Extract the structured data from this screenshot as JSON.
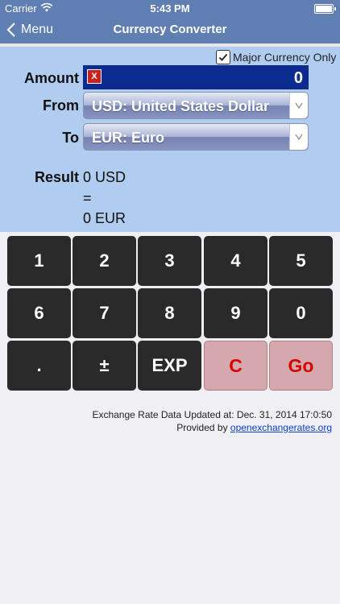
{
  "status": {
    "carrier": "Carrier",
    "time": "5:43 PM"
  },
  "nav": {
    "back_label": "Menu",
    "title": "Currency Converter"
  },
  "form": {
    "major_only_label": "Major Currency Only",
    "major_only_checked": true,
    "amount_label": "Amount",
    "amount_value": "0",
    "clear_label": "X",
    "from_label": "From",
    "from_value": "USD: United States Dollar",
    "to_label": "To",
    "to_value": "EUR: Euro",
    "result_label": "Result",
    "result_from": "0 USD",
    "result_eq": "=",
    "result_to": "0 EUR"
  },
  "keypad": {
    "rows": [
      [
        "1",
        "2",
        "3",
        "4",
        "5"
      ],
      [
        "6",
        "7",
        "8",
        "9",
        "0"
      ],
      [
        ".",
        "±",
        "EXP",
        "C",
        "Go"
      ]
    ]
  },
  "footer": {
    "updated": "Exchange Rate Data Updated at: Dec. 31, 2014 17:0:50",
    "provided_prefix": "Provided by ",
    "provider_link": "openexchangerates.org"
  },
  "colors": {
    "navbar": "#5f7fb2",
    "panel": "#b0cdf0",
    "amount_field": "#0b2b91",
    "key_dark": "#2a2a2a",
    "key_red_bg": "#d4a8ac",
    "key_red_text": "#d80000"
  }
}
